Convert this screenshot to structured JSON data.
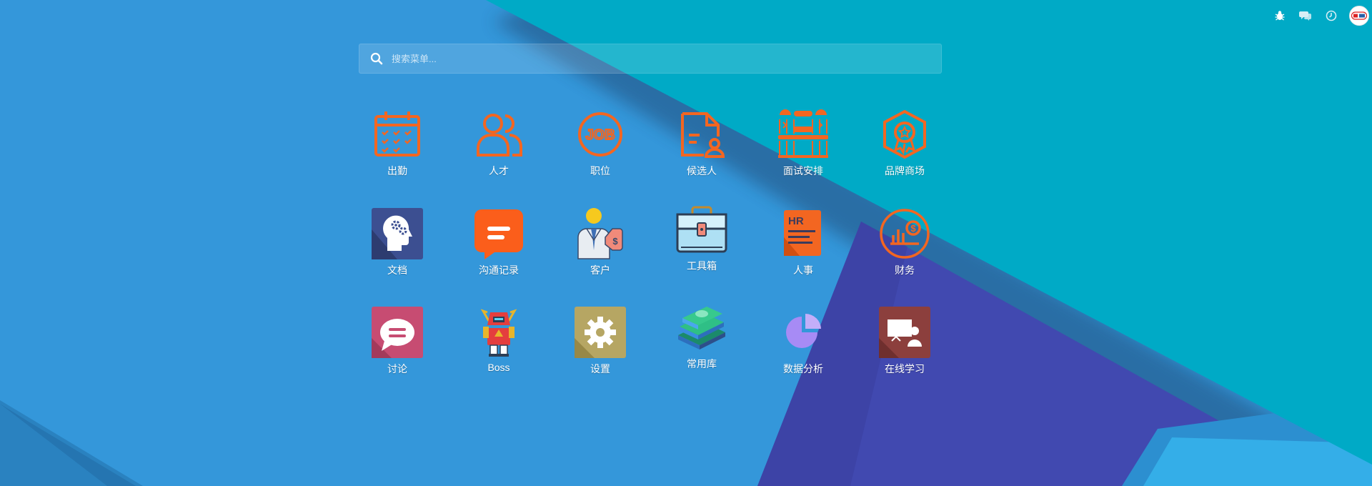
{
  "search": {
    "placeholder": "搜索菜单..."
  },
  "topbar": {
    "icons": [
      "bug-icon",
      "chat-icon",
      "clock-icon",
      "user-avatar"
    ]
  },
  "apps": [
    {
      "label": "出勤",
      "icon": "calendar-icon"
    },
    {
      "label": "人才",
      "icon": "users-icon"
    },
    {
      "label": "职位",
      "icon": "job-icon"
    },
    {
      "label": "候选人",
      "icon": "candidate-document-icon"
    },
    {
      "label": "面试安排",
      "icon": "interview-schedule-icon"
    },
    {
      "label": "品牌商场",
      "icon": "brand-badge-icon"
    },
    {
      "label": "文档",
      "icon": "brain-gear-icon"
    },
    {
      "label": "沟通记录",
      "icon": "message-bubble-icon"
    },
    {
      "label": "客户",
      "icon": "customer-icon"
    },
    {
      "label": "工具箱",
      "icon": "toolbox-icon"
    },
    {
      "label": "人事",
      "icon": "hr-document-icon"
    },
    {
      "label": "财务",
      "icon": "finance-chart-icon"
    },
    {
      "label": "讨论",
      "icon": "discussion-icon"
    },
    {
      "label": "Boss",
      "icon": "robot-boss-icon"
    },
    {
      "label": "设置",
      "icon": "settings-gear-icon"
    },
    {
      "label": "常用库",
      "icon": "books-icon"
    },
    {
      "label": "数据分析",
      "icon": "pie-chart-icon"
    },
    {
      "label": "在线学习",
      "icon": "online-learning-icon"
    }
  ]
}
